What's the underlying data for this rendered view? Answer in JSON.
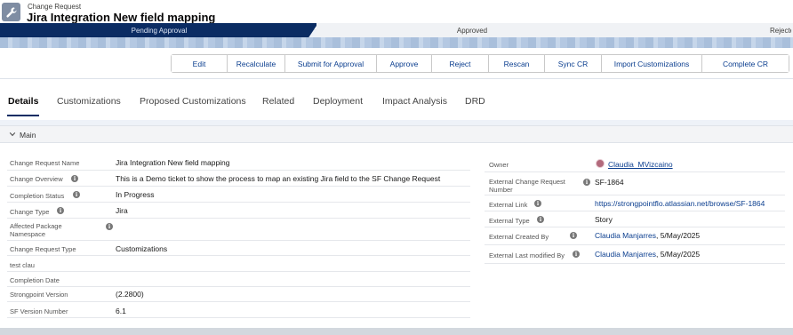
{
  "header": {
    "object_type": "Change Request",
    "title": "Jira Integration New field mapping",
    "icon": "wrench-icon"
  },
  "path": {
    "stages": [
      "Pending Approval",
      "Approved",
      "Rejected"
    ],
    "current": "Pending Approval"
  },
  "actions": [
    {
      "name": "edit-button",
      "label": "Edit"
    },
    {
      "name": "recalculate-button",
      "label": "Recalculate"
    },
    {
      "name": "submit-for-approval-button",
      "label": "Submit for Approval"
    },
    {
      "name": "approve-button",
      "label": "Approve"
    },
    {
      "name": "reject-button",
      "label": "Reject"
    },
    {
      "name": "rescan-button",
      "label": "Rescan"
    },
    {
      "name": "sync-cr-button",
      "label": "Sync CR"
    },
    {
      "name": "import-customizations-button",
      "label": "Import Customizations"
    },
    {
      "name": "complete-cr-button",
      "label": "Complete CR"
    }
  ],
  "tabs": [
    "Details",
    "Customizations",
    "Proposed Customizations",
    "Related",
    "Deployment",
    "Impact Analysis",
    "DRD"
  ],
  "active_tab": "Details",
  "section": {
    "title": "Main"
  },
  "left_fields": [
    {
      "label": "Change Request Name",
      "value": "Jira Integration New field mapping"
    },
    {
      "label": "Change Overview",
      "value": "This is a Demo ticket to show the process to map an existing Jira field to the SF Change Request"
    },
    {
      "label": "Completion Status",
      "value": "In Progress"
    },
    {
      "label": "Change Type",
      "value": "Jira"
    },
    {
      "label": "Affected Package Namespace",
      "value": ""
    },
    {
      "label": "Change Request Type",
      "value": "Customizations"
    },
    {
      "label": "test clau",
      "value": ""
    },
    {
      "label": "Completion Date",
      "value": ""
    },
    {
      "label": "Strongpoint Version",
      "value": "(2.2800)"
    },
    {
      "label": "SF Version Number",
      "value": "6.1"
    }
  ],
  "right_fields": [
    {
      "label": "Owner",
      "value": "Claudia_MVizcaino"
    },
    {
      "label": "External Change Request Number",
      "value": "SF-1864"
    },
    {
      "label": "External Link",
      "value": "https://strongpointflo.atlassian.net/browse/SF-1864"
    },
    {
      "label": "External Type",
      "value": "Story"
    },
    {
      "label": "External Created By",
      "value": "Claudia Manjarres",
      "suffix": ", 5/May/2025"
    },
    {
      "label": "External Last modified By",
      "value": "Claudia Manjarres",
      "suffix": ", 5/May/2025"
    }
  ],
  "colors": {
    "brand_navy": "#0b2c63",
    "link": "#0b3e8f",
    "path_band": "#a9bfdb"
  }
}
